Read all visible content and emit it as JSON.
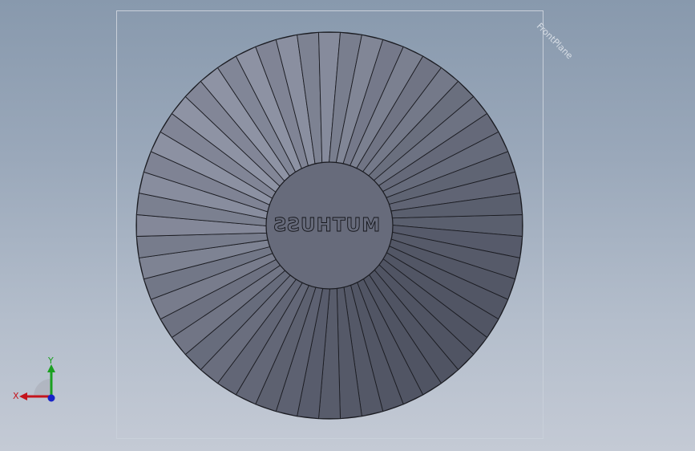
{
  "viewport": {
    "plane_label": "FrontPlane",
    "model": {
      "engraved_text": "MUTHUSS",
      "rib_count": 56,
      "colors": {
        "face_light": "#8e93a4",
        "face_mid": "#6e7283",
        "face_dark": "#505463",
        "hub": "#676b7b",
        "edge": "#1b1c22"
      }
    },
    "triad": {
      "x_label": "X",
      "y_label": "Y",
      "colors": {
        "x": "#c4141c",
        "y": "#1aa020",
        "z": "#1722c8"
      }
    }
  }
}
